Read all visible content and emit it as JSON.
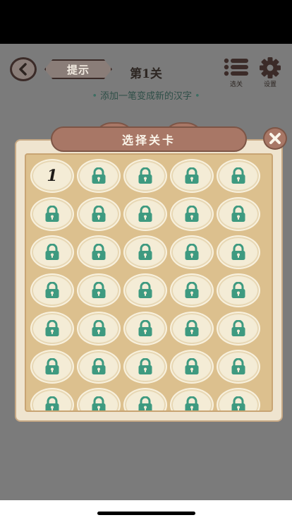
{
  "header": {
    "hint_label": "提示",
    "level_title": "第1关",
    "subtitle": "添加一笔变成新的汉字",
    "menu_label": "选关",
    "settings_label": "设置"
  },
  "dialog": {
    "title": "选择关卡",
    "levels": [
      {
        "label": "1",
        "locked": false
      },
      {
        "label": "",
        "locked": true
      },
      {
        "label": "",
        "locked": true
      },
      {
        "label": "",
        "locked": true
      },
      {
        "label": "",
        "locked": true
      },
      {
        "label": "",
        "locked": true
      },
      {
        "label": "",
        "locked": true
      },
      {
        "label": "",
        "locked": true
      },
      {
        "label": "",
        "locked": true
      },
      {
        "label": "",
        "locked": true
      },
      {
        "label": "",
        "locked": true
      },
      {
        "label": "",
        "locked": true
      },
      {
        "label": "",
        "locked": true
      },
      {
        "label": "",
        "locked": true
      },
      {
        "label": "",
        "locked": true
      },
      {
        "label": "",
        "locked": true
      },
      {
        "label": "",
        "locked": true
      },
      {
        "label": "",
        "locked": true
      },
      {
        "label": "",
        "locked": true
      },
      {
        "label": "",
        "locked": true
      },
      {
        "label": "",
        "locked": true
      },
      {
        "label": "",
        "locked": true
      },
      {
        "label": "",
        "locked": true
      },
      {
        "label": "",
        "locked": true
      },
      {
        "label": "",
        "locked": true
      },
      {
        "label": "",
        "locked": true
      },
      {
        "label": "",
        "locked": true
      },
      {
        "label": "",
        "locked": true
      },
      {
        "label": "",
        "locked": true
      },
      {
        "label": "",
        "locked": true
      },
      {
        "label": "",
        "locked": true
      },
      {
        "label": "",
        "locked": true
      },
      {
        "label": "",
        "locked": true
      },
      {
        "label": "",
        "locked": true
      },
      {
        "label": "",
        "locked": true
      }
    ]
  },
  "colors": {
    "lock": "#3e9a80",
    "ribbon": "#a87766",
    "panel": "#efe4cf",
    "panel_inner": "#dcc08e"
  }
}
